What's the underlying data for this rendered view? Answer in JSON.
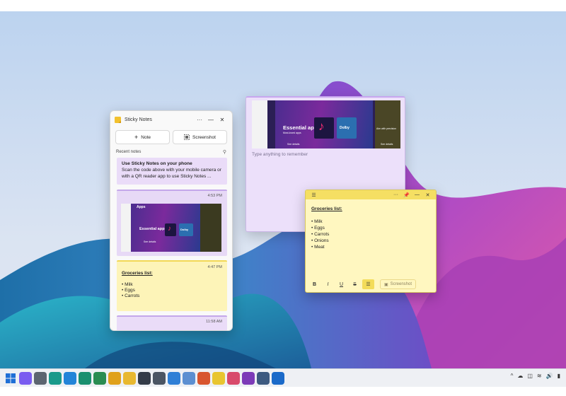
{
  "hub": {
    "title": "Sticky Notes",
    "more_glyph": "···",
    "minimize_glyph": "—",
    "close_glyph": "✕",
    "note_button": "Note",
    "screenshot_button": "Screenshot",
    "recent_label": "Recent notes",
    "intro_card": {
      "title": "Use Sticky Notes on your phone",
      "body": "Scan the code above with your mobile camera or with a QR reader app to use Sticky Notes ..."
    },
    "screenshot_card": {
      "time": "4:53 PM",
      "thumb_heading": "Apps",
      "thumb_title": "Essential apps",
      "thumb_label": "Dolby",
      "thumb_link": "See details"
    },
    "grocery_card": {
      "time": "4:47 PM",
      "heading": "Groceries list:",
      "items": [
        "• Milk",
        "• Eggs",
        "• Carrots"
      ]
    },
    "last_card": {
      "time": "11:58 AM"
    }
  },
  "purple_note": {
    "thumb_title": "Essential apps",
    "thumb_sub": "Most-loved apps",
    "thumb_label": "Dolby",
    "thumb_link": "See details",
    "thumb_right_title": "Aim with precision",
    "thumb_right_link": "See details",
    "placeholder": "Type anything to remember"
  },
  "yellow_note": {
    "heading": "Groceries list:",
    "items": [
      "• Milk",
      "• Eggs",
      "• Carrots",
      "• Onions",
      "• Meat"
    ],
    "bold": "B",
    "italic": "I",
    "underline": "U",
    "strike": "S",
    "screenshot_button": "Screenshot"
  },
  "taskbar": {
    "icons": [
      {
        "name": "start",
        "color": "#1f6fd6"
      },
      {
        "name": "copilot",
        "color": "#7a5cf0"
      },
      {
        "name": "settings",
        "color": "#5c6570"
      },
      {
        "name": "edge",
        "color": "#1a9a8b"
      },
      {
        "name": "edge-beta",
        "color": "#2384d8"
      },
      {
        "name": "edge-dev",
        "color": "#1a8f6f"
      },
      {
        "name": "edge-canary",
        "color": "#2a8c52"
      },
      {
        "name": "chrome",
        "color": "#e0a11c"
      },
      {
        "name": "file-explorer",
        "color": "#e8b830"
      },
      {
        "name": "terminal",
        "color": "#333b48"
      },
      {
        "name": "chatgpt",
        "color": "#4b5563"
      },
      {
        "name": "notepad",
        "color": "#2f7fd6"
      },
      {
        "name": "mail",
        "color": "#5c8fd1"
      },
      {
        "name": "photos",
        "color": "#d8552f"
      },
      {
        "name": "sticky-notes",
        "color": "#e8c530"
      },
      {
        "name": "snipping-tool",
        "color": "#d84a6b"
      },
      {
        "name": "onenote",
        "color": "#7d3bb8"
      },
      {
        "name": "calculator",
        "color": "#3d5a80"
      },
      {
        "name": "outlook",
        "color": "#1b6ac9"
      }
    ],
    "tray": [
      "^",
      "☁",
      "◫",
      "≋",
      "🔊",
      "▮"
    ]
  }
}
